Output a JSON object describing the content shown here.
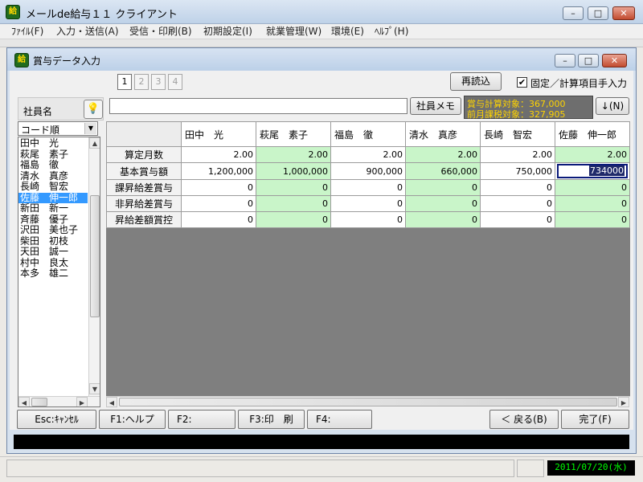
{
  "app": {
    "title": "メールde給与１１ クライアント",
    "icon_label": "給"
  },
  "window_controls": {
    "minimize": "–",
    "maximize": "□",
    "close": "✕"
  },
  "menu": [
    "ﾌｧｲﾙ(F)",
    "入力・送信(A)",
    "受信・印刷(B)",
    "初期設定(I)",
    "就業管理(W)",
    "環境(E)",
    "ﾍﾙﾌﾟ(H)"
  ],
  "inner": {
    "title": "賞与データ入力",
    "icon_label": "給"
  },
  "page_tabs": [
    "1",
    "2",
    "3",
    "4"
  ],
  "toolbar": {
    "reload": "再読込",
    "fixed_calc_label": "固定／計算項目手入力",
    "fixed_calc_checked": "✔",
    "memo_button": "社員メモ",
    "memo_value": "",
    "calc_target": "賞与計算対象：367,000",
    "prev_taxable": "前月課税対象：327,905",
    "down_button": "↓(N)"
  },
  "employee_panel": {
    "header": "社員名",
    "bulb_icon": "💡",
    "sort_option": "コード順",
    "employees": [
      "田中　光",
      "萩尾　素子",
      "福島　徹",
      "清水　真彦",
      "長崎　智宏",
      "佐藤　伸一郎",
      "新田　新一",
      "斉藤　優子",
      "沢田　美也子",
      "柴田　初枝",
      "天田　誠一",
      "村中　良太",
      "本多　雄二"
    ],
    "selected_index": 5
  },
  "grid": {
    "columns": [
      "田中　光",
      "萩尾　素子",
      "福島　徹",
      "清水　真彦",
      "長崎　智宏",
      "佐藤　伸一郎"
    ],
    "rows": [
      {
        "label": "算定月数",
        "values": [
          "2.00",
          "2.00",
          "2.00",
          "2.00",
          "2.00",
          "2.00"
        ]
      },
      {
        "label": "基本賞与額",
        "values": [
          "1,200,000",
          "1,000,000",
          "900,000",
          "660,000",
          "750,000",
          "734000"
        ]
      },
      {
        "label": "課昇給差賞与",
        "values": [
          "0",
          "0",
          "0",
          "0",
          "0",
          "0"
        ]
      },
      {
        "label": "非昇給差賞与",
        "values": [
          "0",
          "0",
          "0",
          "0",
          "0",
          "0"
        ]
      },
      {
        "label": "昇給差額賞控",
        "values": [
          "0",
          "0",
          "0",
          "0",
          "0",
          "0"
        ]
      }
    ],
    "editing": {
      "row": 1,
      "col": 5
    }
  },
  "function_keys": {
    "esc": "Esc:ｷｬﾝｾﾙ",
    "f1": "F1:ヘルプ",
    "f2": "F2:",
    "f3": "F3:印　刷",
    "f4": "F4:",
    "back": "＜ 戻る(B)",
    "done": "完了(F)"
  },
  "scroll_arrows": {
    "up": "▲",
    "down": "▼",
    "left": "◀",
    "right": "▶"
  },
  "status": {
    "date": "2011/07/20(水)"
  },
  "colors": {
    "alt_column": "#c9f5c9",
    "selection": "#3399ff",
    "date_text": "#00ff00"
  }
}
